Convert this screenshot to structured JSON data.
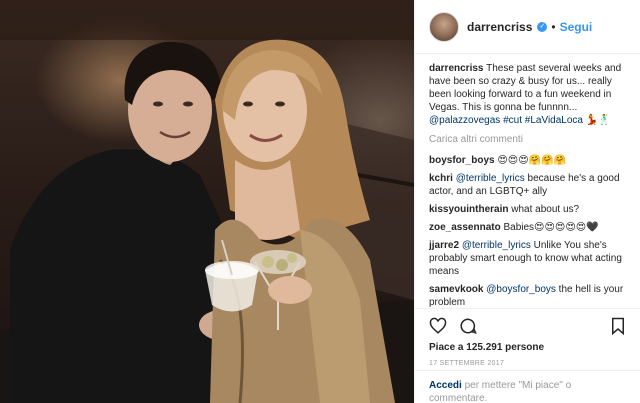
{
  "post": {
    "username": "darrencriss",
    "follow_label": "Segui",
    "separator": "•",
    "verified_glyph": "✓",
    "caption_user": "darrencriss",
    "caption_text": " These past several weeks and have been so crazy & busy for us... really been looking forward to a fun weekend in Vegas. This is gonna be funnnn... ",
    "caption_tag1": "@palazzovegas",
    "caption_tag2": " #cut",
    "caption_tag3": "#LaVidaLoca",
    "caption_emoji": " 💃🕺",
    "load_more": "Carica altri commenti",
    "likes": "Piace a 125.291 persone",
    "date": "17 SETTEMBRE 2017",
    "login_link": "Accedi",
    "login_text": " per mettere \"Mi piace\" o commentare."
  },
  "comments": [
    {
      "user": "boysfor_boys",
      "text": " 😍😍😍🤗🤗🤗"
    },
    {
      "user": "kchri",
      "mention": "@terrible_lyrics",
      "text": " because he's a good actor, and an LGBTQ+ ally"
    },
    {
      "user": "kissyouintherain",
      "text": " what about us?"
    },
    {
      "user": "zoe_assennato",
      "text": " Babies😍😍😍😍😍🖤"
    },
    {
      "user": "jjarre2",
      "mention": "@terrible_lyrics",
      "text": " Unlike You she's probably smart enough to know what acting means"
    },
    {
      "user": "samevkook",
      "mention": "@boysfor_boys",
      "text": " the hell is your problem"
    }
  ],
  "icons": {
    "like": "heart-icon",
    "comment": "comment-icon",
    "save": "bookmark-icon",
    "verified": "verified-badge-icon"
  },
  "colors": {
    "link_blue": "#3897f0",
    "tag_blue": "#003569",
    "muted": "#999999",
    "border": "#efefef"
  }
}
